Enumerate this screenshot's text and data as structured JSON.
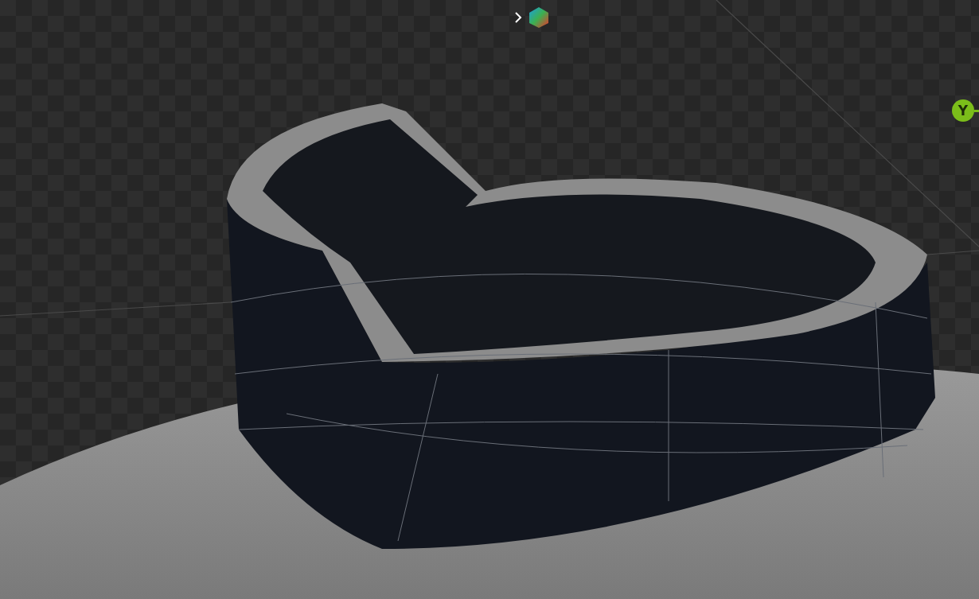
{
  "viewport": {
    "gizmo": {
      "y_axis_label": "Y"
    }
  }
}
